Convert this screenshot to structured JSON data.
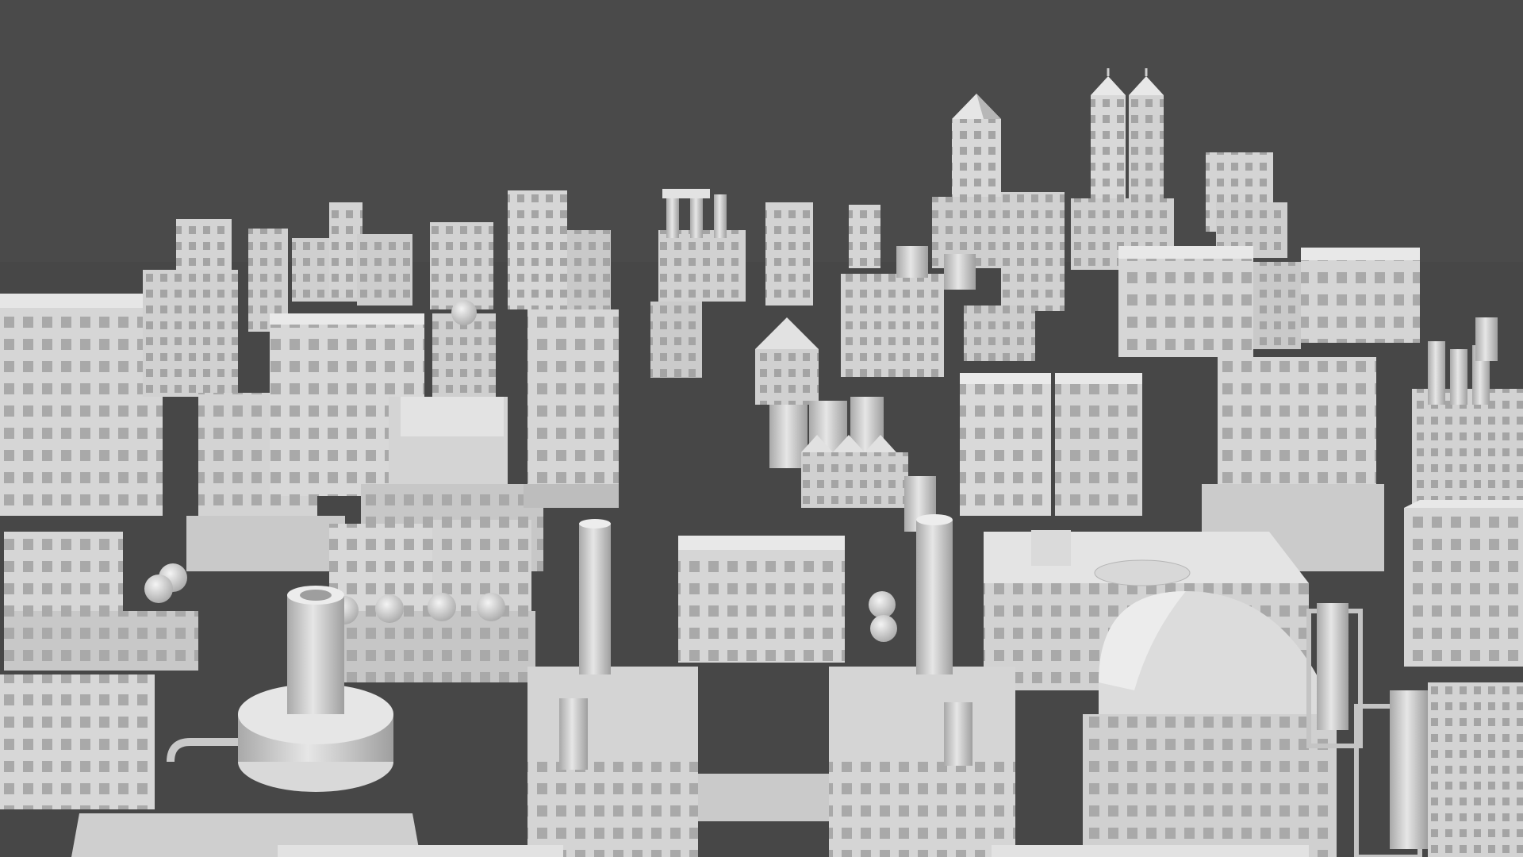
{
  "scene": {
    "background": "#4a4a4a",
    "ground": "#4b4b4b",
    "model_color": "#d9d9d9",
    "palette": {
      "top": "#e8e8e8",
      "front": "#d2d2d2",
      "side": "#b3b3b3",
      "shade": "#9a9a9a",
      "window": "#a3a3a3",
      "edge": "#8e8e8e"
    }
  }
}
